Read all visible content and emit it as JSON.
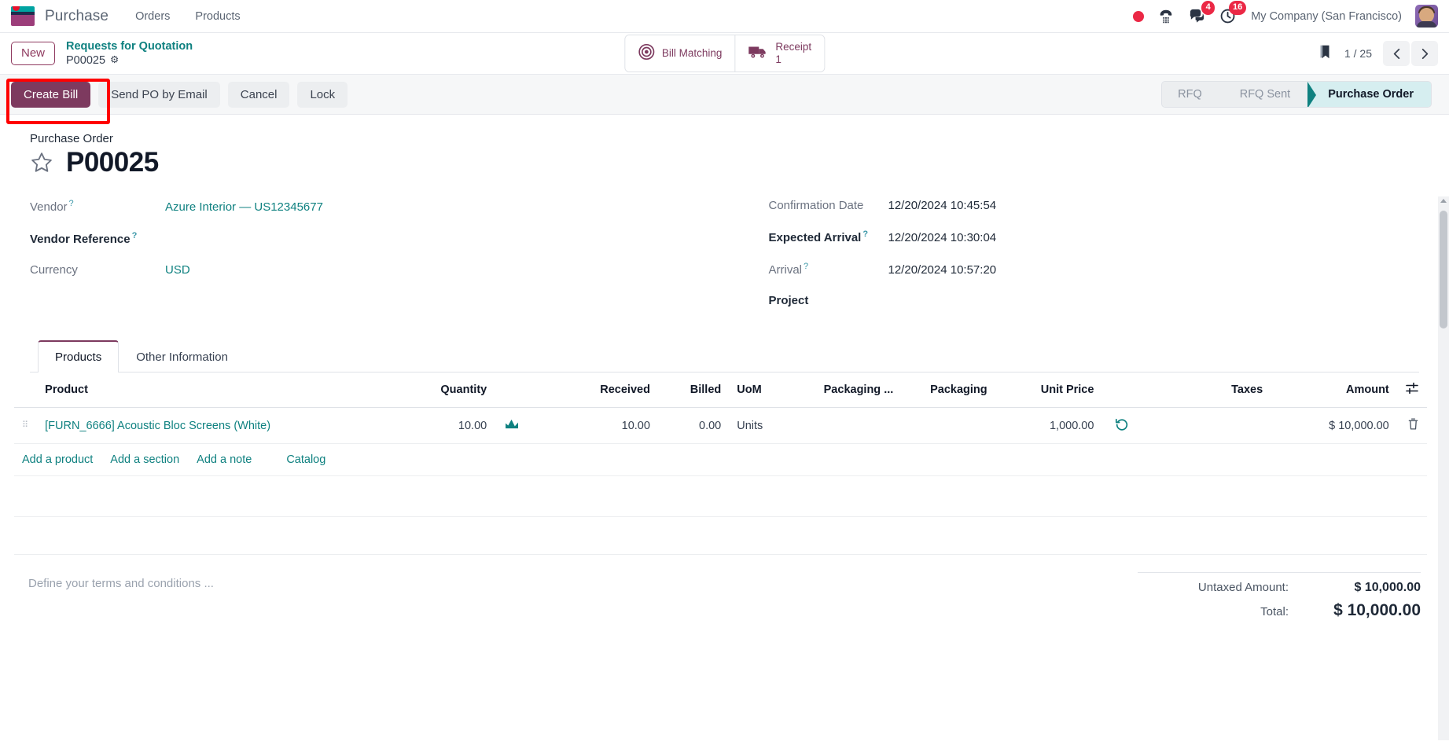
{
  "navbar": {
    "app_name": "Purchase",
    "logo_icon": "odoo-purchase-logo",
    "menus": [
      {
        "label": "Orders",
        "name": "orders"
      },
      {
        "label": "Products",
        "name": "products"
      }
    ],
    "record_icon": "record-dot-icon",
    "phone_icon": "phone-icon",
    "messages_icon": "messages-icon",
    "messages_count": "4",
    "activities_icon": "clock-activities-icon",
    "activities_count": "16",
    "company": "My Company (San Francisco)",
    "avatar_icon": "user-avatar"
  },
  "control": {
    "new_label": "New",
    "breadcrumb_parent": "Requests for Quotation",
    "breadcrumb_current": "P00025",
    "gear_icon": "gear-icon",
    "stat_buttons": [
      {
        "name": "bill-matching",
        "icon": "target-icon",
        "label": "Bill Matching",
        "value": ""
      },
      {
        "name": "receipt",
        "icon": "truck-icon",
        "label": "Receipt",
        "value": "1"
      }
    ],
    "bookmark_icon": "bookmark-icon",
    "pager": "1 / 25",
    "prev_icon": "chevron-left-icon",
    "next_icon": "chevron-right-icon"
  },
  "actions": {
    "primary": "Create Bill",
    "buttons": [
      {
        "label": "Send PO by Email",
        "name": "send-po-by-email-button"
      },
      {
        "label": "Cancel",
        "name": "cancel-button"
      },
      {
        "label": "Lock",
        "name": "lock-button"
      }
    ],
    "highlight_color": "#ff0000",
    "statuses": [
      {
        "label": "RFQ",
        "active": false
      },
      {
        "label": "RFQ Sent",
        "active": false
      },
      {
        "label": "Purchase Order",
        "active": true
      }
    ]
  },
  "record": {
    "sheet_subtitle": "Purchase Order",
    "star_icon": "star-outline-icon",
    "title": "P00025",
    "left_fields": [
      {
        "label": "Vendor",
        "help": "?",
        "value": "Azure Interior — US12345677",
        "link": true,
        "bold_label": false
      },
      {
        "label": "Vendor Reference",
        "help": "?",
        "value": "",
        "link": false,
        "bold_label": true
      },
      {
        "label": "Currency",
        "help": "",
        "value": "USD",
        "link": true,
        "bold_label": false
      }
    ],
    "right_fields": [
      {
        "label": "Confirmation Date",
        "help": "",
        "value": "12/20/2024 10:45:54",
        "bold_label": false
      },
      {
        "label": "Expected Arrival",
        "help": "?",
        "value": "12/20/2024 10:30:04",
        "bold_label": true
      },
      {
        "label": "Arrival",
        "help": "?",
        "value": "12/20/2024 10:57:20",
        "bold_label": false
      },
      {
        "label": "Project",
        "help": "",
        "value": "",
        "bold_label": true
      }
    ]
  },
  "notebook": {
    "tabs": [
      {
        "label": "Products",
        "active": true
      },
      {
        "label": "Other Information",
        "active": false
      }
    ]
  },
  "lines_table": {
    "columns": [
      "Product",
      "Quantity",
      "Received",
      "Billed",
      "UoM",
      "Packaging ...",
      "Packaging",
      "Unit Price",
      "Taxes",
      "Amount"
    ],
    "optional_columns_icon": "column-settings-icon",
    "rows": [
      {
        "drag_icon": "drag-handle-icon",
        "product": "[FURN_6666] Acoustic Bloc Screens (White)",
        "quantity": "10.00",
        "forecast_icon": "forecast-graph-icon",
        "received": "10.00",
        "billed": "0.00",
        "uom": "Units",
        "packaging_qty": "",
        "packaging": "",
        "unit_price": "1,000.00",
        "history_icon": "purchase-history-icon",
        "taxes": "",
        "amount": "$ 10,000.00",
        "delete_icon": "trash-icon"
      }
    ],
    "add_links": [
      {
        "label": "Add a product",
        "name": "add-a-product-link"
      },
      {
        "label": "Add a section",
        "name": "add-a-section-link"
      },
      {
        "label": "Add a note",
        "name": "add-a-note-link"
      },
      {
        "label": "Catalog",
        "name": "catalog-link"
      }
    ]
  },
  "footer": {
    "terms_placeholder": "Define your terms and conditions ...",
    "untaxed_label": "Untaxed Amount:",
    "untaxed_value": "$ 10,000.00",
    "total_label": "Total:",
    "total_value": "$ 10,000.00"
  },
  "colors": {
    "brand_purple": "#7d3a5f",
    "teal": "#0f8180",
    "status_active_bg": "#d6eef0",
    "badge_red": "#eb2845"
  }
}
